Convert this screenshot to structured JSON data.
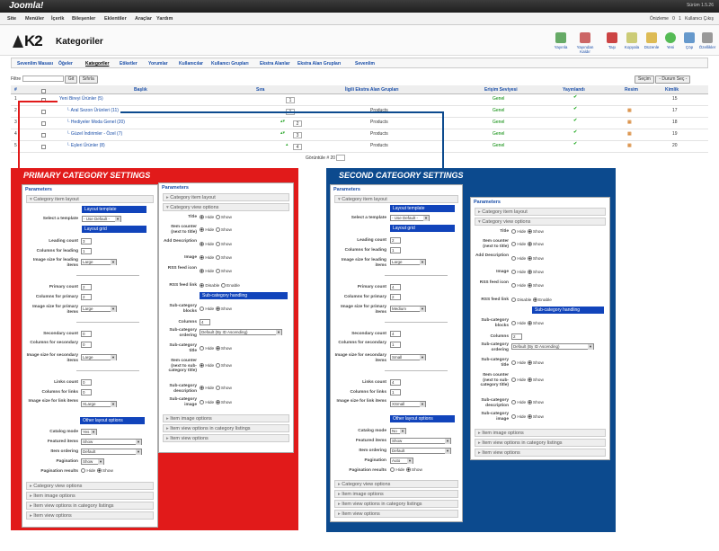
{
  "topbar": {
    "logo": "Joomla!",
    "version": "Sürüm 1.5.26"
  },
  "menu": [
    "Site",
    "Menüler",
    "İçerik",
    "Bileşenler",
    "Eklentiler",
    "Araçlar",
    "Yardım"
  ],
  "status": {
    "preview": "Önizleme",
    "msgs": "0",
    "users": "1",
    "logout": "Kullanıcı Çıkış"
  },
  "header": {
    "brand": "K2",
    "title": "Kategoriler"
  },
  "toolbar": [
    "Yayınla",
    "Yayından Kaldır",
    "Taşı",
    "Kopyala",
    "Düzenle",
    "Yeni",
    "Çöp",
    "Özellikler"
  ],
  "subnav": [
    "Sevenlim Masası",
    "Öğeler",
    "Kategoriler",
    "Etiketler",
    "Yorumlar",
    "Kullanıcılar",
    "Kullanıcı Grupları",
    "Ekstra Alanlar",
    "Ekstra Alan Grupları",
    "Sevenlim"
  ],
  "filter": {
    "label": "Filtre",
    "go": "Git",
    "reset": "Sıfırla",
    "sel1": "Seçim",
    "sel2": "- Durum Seç -"
  },
  "table": {
    "headers": [
      "#",
      "",
      "Başlık",
      "Sıra",
      "İlgili Ekstra Alan Grupları",
      "Erişim Seviyesi",
      "Yayınlandı",
      "Resim",
      "Kimlik"
    ],
    "rows": [
      {
        "n": "1",
        "title": "Yeni Bireyi Ürünler (5)",
        "order": "1",
        "group": "",
        "access": "Genel",
        "id": "15"
      },
      {
        "n": "2",
        "title": "└ Aral Sezon Ürünleri (11)",
        "order": "1",
        "group": "Products",
        "access": "Genel",
        "id": "17"
      },
      {
        "n": "3",
        "title": "└ Hediyeler Moda Genel (20)",
        "order": "2",
        "group": "Products",
        "access": "Genel",
        "id": "18"
      },
      {
        "n": "4",
        "title": "└ Güzel İndirimler - Özel (7)",
        "order": "3",
        "group": "Products",
        "access": "Genel",
        "id": "19"
      },
      {
        "n": "5",
        "title": "└ Eşleri Ürünler (8)",
        "order": "4",
        "group": "Products",
        "access": "Genel",
        "id": "20"
      }
    ]
  },
  "pager": "Görüntüle # 20",
  "primary": {
    "title": "PRIMARY CATEGORY SETTINGS",
    "params": "Parameters",
    "item_layout_sec": "Category item layout",
    "layout_template": "Layout template",
    "select_template": "Select a template",
    "template_val": "- Use Default -",
    "layout_grid": "Layout grid",
    "leading_count": "Leading count",
    "leading_count_val": "3",
    "cols_leading": "Columns for leading",
    "cols_leading_val": "1",
    "img_leading": "Image size for leading items",
    "img_leading_val": "Large",
    "primary_count": "Primary count",
    "primary_count_val": "2",
    "cols_primary": "Columns for primary",
    "cols_primary_val": "2",
    "img_primary": "Image size for primary items",
    "img_primary_val": "Large",
    "secondary_count": "Secondary count",
    "secondary_count_val": "0",
    "cols_secondary": "Columns for secondary",
    "cols_secondary_val": "0",
    "img_secondary": "Image size for secondary items",
    "img_secondary_val": "Large",
    "links_count": "Links count",
    "links_count_val": "0",
    "cols_links": "Columns for links",
    "cols_links_val": "0",
    "img_links": "Image size for link items",
    "img_links_val": "XLarge",
    "other_layout": "Other layout options",
    "catalog_mode": "Catalog mode",
    "catalog_mode_val": "Yes",
    "featured": "Featured items",
    "featured_val": "Show",
    "ordering": "Item ordering",
    "ordering_val": "Default",
    "pagination": "Pagination",
    "pagination_val": "Show",
    "pag_results": "Pagination results",
    "hide": "Hide",
    "show": "Show",
    "sec_view": "Category view options",
    "sec_image": "Item image options",
    "sec_listing": "Item view options in category listings",
    "sec_itemview": "Item view options"
  },
  "primary2": {
    "params": "Parameters",
    "item_layout_sec": "Category item layout",
    "view_sec": "Category view options",
    "title": "Title",
    "item_counter": "Item counter (next to title)",
    "add_desc": "Add Description",
    "image": "Image",
    "rss_icon": "RSS feed icon",
    "rss_link": "RSS feed link",
    "disable": "Disable",
    "enable": "Enable",
    "subcat_handling": "Sub-category handling",
    "subcat_blocks": "Sub-category blocks",
    "columns": "Columns",
    "columns_val": "4",
    "subcat_ordering": "Sub-category ordering",
    "subcat_ordering_val": "Default (By ID Ascending)",
    "subcat_title": "Sub-category title",
    "item_counter_sub": "Item counter (next to sub-category title)",
    "subcat_desc": "Sub-category description",
    "subcat_image": "Sub-category image",
    "hide": "Hide",
    "show": "Show",
    "sec_image": "Item image options",
    "sec_listing": "Item view options in category listings",
    "sec_itemview": "Item view options"
  },
  "second": {
    "title": "SECOND CATEGORY SETTINGS",
    "leading_count_val": "2",
    "cols_leading_val": "1",
    "img_leading_val": "Large",
    "primary_count_val": "4",
    "cols_primary_val": "2",
    "img_primary_val": "Medium",
    "secondary_count_val": "4",
    "cols_secondary_val": "1",
    "img_secondary_val": "Small",
    "links_count_val": "4",
    "cols_links_val": "1",
    "img_links_val": "XSmall",
    "catalog_mode_val": "No",
    "featured_val": "Show",
    "ordering_val": "Default",
    "pagination_val": "Auto",
    "columns_val": "2"
  }
}
